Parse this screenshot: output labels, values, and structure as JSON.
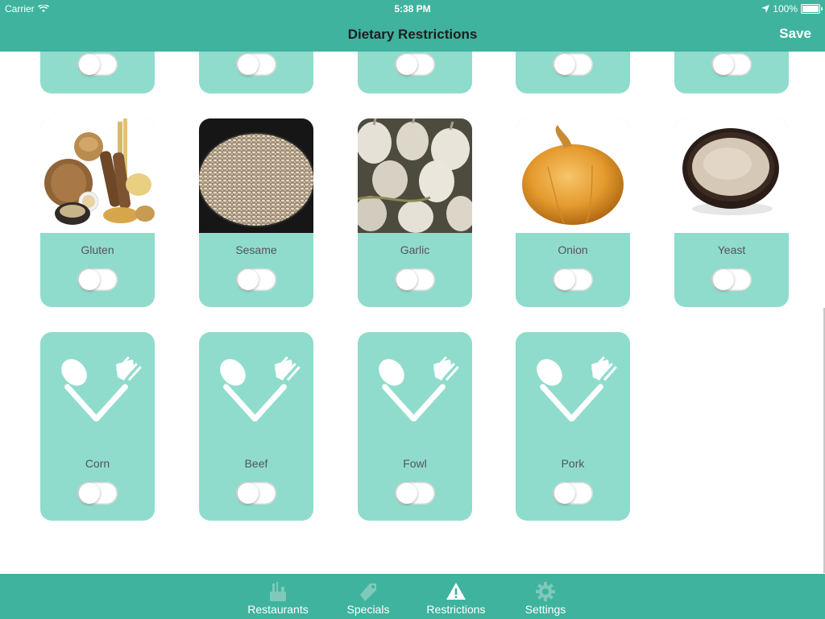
{
  "status_bar": {
    "carrier": "Carrier",
    "time": "5:38 PM",
    "battery": "100%"
  },
  "nav": {
    "title": "Dietary Restrictions",
    "save_label": "Save"
  },
  "row1_partial": [
    {
      "toggle_on": false
    },
    {
      "toggle_on": false
    },
    {
      "toggle_on": false
    },
    {
      "toggle_on": false
    },
    {
      "toggle_on": false
    }
  ],
  "row2": [
    {
      "label": "Gluten",
      "image": "bread-grains-photo",
      "toggle_on": false
    },
    {
      "label": "Sesame",
      "image": "sesame-seeds-photo",
      "toggle_on": false
    },
    {
      "label": "Garlic",
      "image": "garlic-bulbs-photo",
      "toggle_on": false
    },
    {
      "label": "Onion",
      "image": "onion-photo",
      "toggle_on": false
    },
    {
      "label": "Yeast",
      "image": "yeast-bowl-photo",
      "toggle_on": false
    }
  ],
  "row3": [
    {
      "label": "Corn",
      "icon": "spoon-fork-icon",
      "toggle_on": false
    },
    {
      "label": "Beef",
      "icon": "spoon-fork-icon",
      "toggle_on": false
    },
    {
      "label": "Fowl",
      "icon": "spoon-fork-icon",
      "toggle_on": false
    },
    {
      "label": "Pork",
      "icon": "spoon-fork-icon",
      "toggle_on": false
    }
  ],
  "tabs": [
    {
      "label": "Restaurants",
      "icon": "restaurant-icon",
      "selected": false
    },
    {
      "label": "Specials",
      "icon": "tag-icon",
      "selected": false
    },
    {
      "label": "Restrictions",
      "icon": "warning-icon",
      "selected": true
    },
    {
      "label": "Settings",
      "icon": "gear-icon",
      "selected": false
    }
  ],
  "colors": {
    "accent": "#3fb39e",
    "card": "#8fdccd",
    "selected_tab": "#ffffff",
    "unselected_tab_icon": "#7fc9bb"
  }
}
